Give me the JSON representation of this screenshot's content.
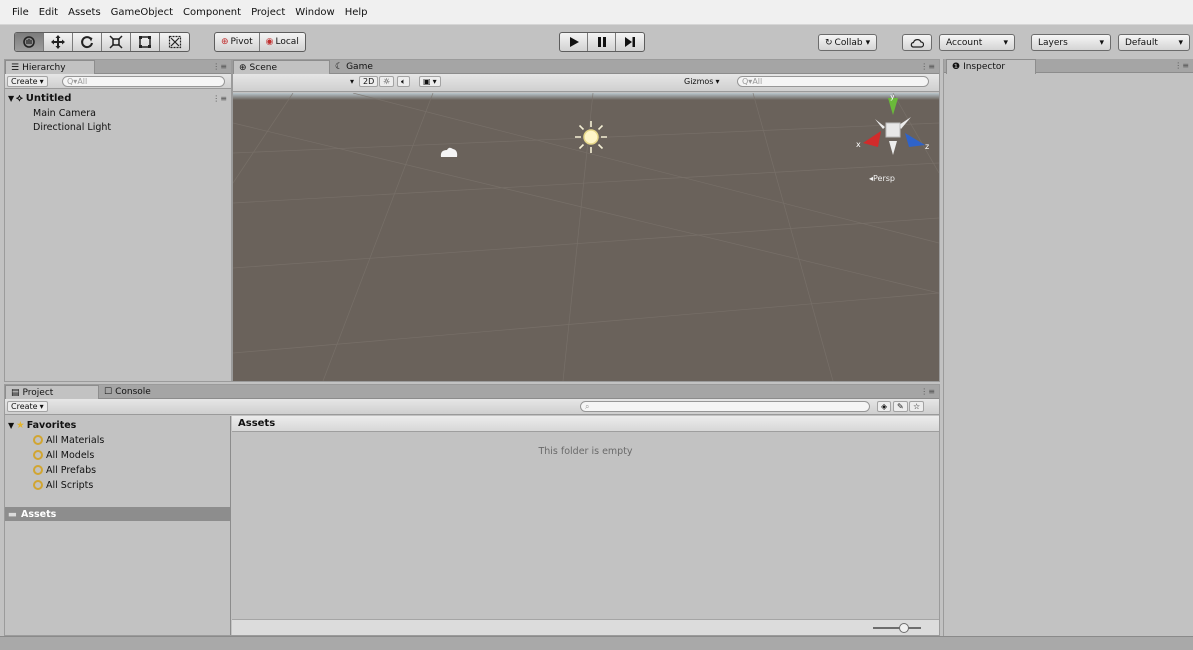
{
  "menu": [
    "File",
    "Edit",
    "Assets",
    "GameObject",
    "Component",
    "Project",
    "Window",
    "Help"
  ],
  "toolbar": {
    "tools": [
      "hand-tool",
      "move-tool",
      "rotate-tool",
      "scale-tool",
      "rect-tool",
      "transform-tool"
    ],
    "pivot_label": "Pivot",
    "local_label": "Local",
    "collab_label": "Collab",
    "account_label": "Account",
    "layers_label": "Layers",
    "layout_label": "Default",
    "dropdown_arrow": "▾"
  },
  "hierarchy": {
    "tab_label": "Hierarchy",
    "create_label": "Create",
    "search_placeholder": "Q▾All",
    "scene_name": "Untitled",
    "items": [
      "Main Camera",
      "Directional Light"
    ]
  },
  "scene": {
    "tab_scene": "Scene",
    "tab_game": "Game",
    "shading_mode": "",
    "mode_2d": "2D",
    "gizmos_label": "Gizmos",
    "search_placeholder": "Q▾All",
    "persp_label": "Persp",
    "axis_x": "x",
    "axis_y": "y",
    "axis_z": "z"
  },
  "inspector": {
    "tab_label": "Inspector"
  },
  "project": {
    "tab_project": "Project",
    "tab_console": "Console",
    "create_label": "Create",
    "favorites_label": "Favorites",
    "favorites": [
      "All Materials",
      "All Models",
      "All Prefabs",
      "All Scripts"
    ],
    "assets_folder": "Assets",
    "assets_header": "Assets",
    "empty_message": "This folder is empty"
  },
  "colors": {
    "scene_bg": "#6a625b",
    "panel_bg": "#c2c2c2",
    "selection": "#8d8d8d",
    "gizmo_x": "#d12b2b",
    "gizmo_y": "#6ab93a",
    "gizmo_z": "#2f63c9"
  }
}
